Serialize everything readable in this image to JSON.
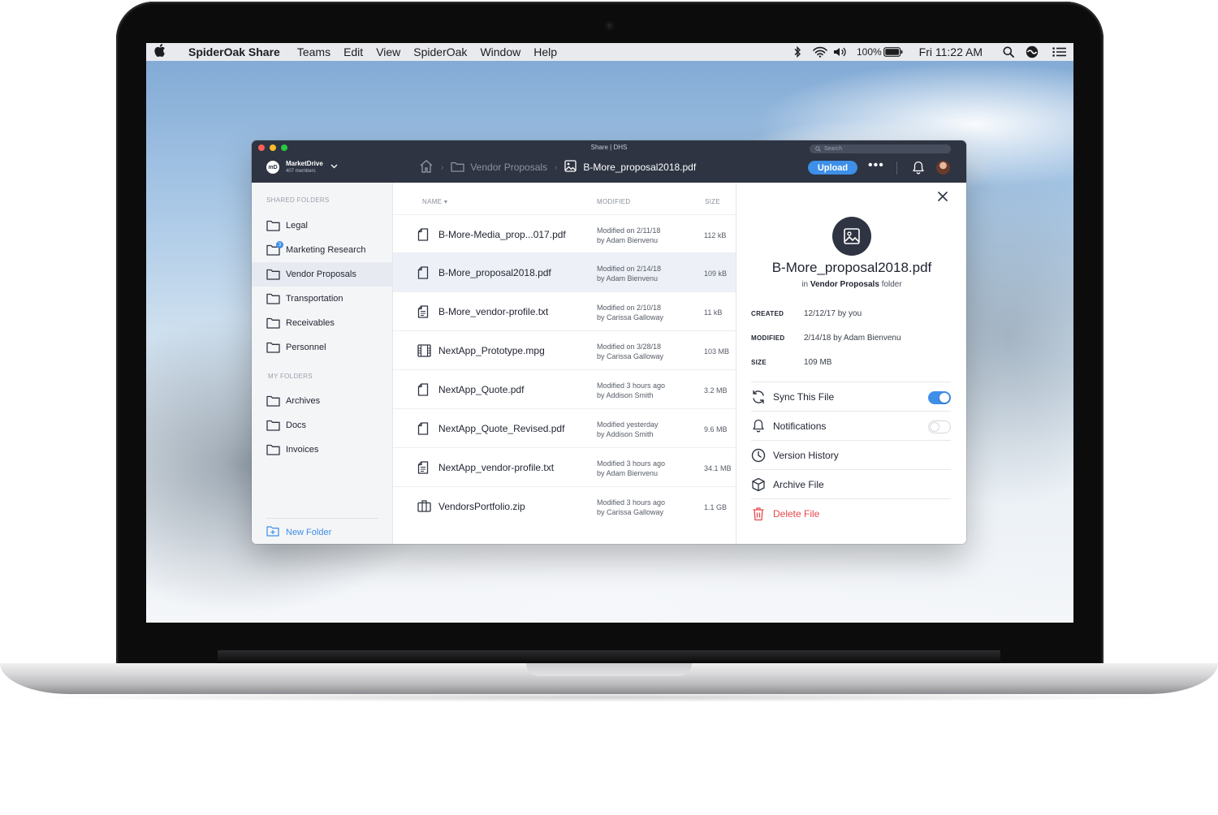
{
  "menubar": {
    "app_name": "SpiderOak Share",
    "menus": [
      "Teams",
      "Edit",
      "View",
      "SpiderOak",
      "Window",
      "Help"
    ],
    "battery": "100%",
    "clock": "Fri 11:22 AM"
  },
  "window": {
    "title": "Share | DHS",
    "search_placeholder": "Search",
    "workspace": {
      "name": "MarketDrive",
      "members": "407 members",
      "logo": "mD"
    },
    "breadcrumb": {
      "parent": "Vendor Proposals",
      "current": "B-More_proposal2018.pdf"
    },
    "upload_label": "Upload",
    "more_label": "•••"
  },
  "sidebar": {
    "shared_label": "SHARED FOLDERS",
    "shared": [
      {
        "label": "Legal"
      },
      {
        "label": "Marketing Research",
        "badge": "3"
      },
      {
        "label": "Vendor Proposals",
        "active": true
      },
      {
        "label": "Transportation"
      },
      {
        "label": "Receivables"
      },
      {
        "label": "Personnel"
      }
    ],
    "my_label": "MY FOLDERS",
    "mine": [
      {
        "label": "Archives"
      },
      {
        "label": "Docs"
      },
      {
        "label": "Invoices"
      }
    ],
    "new_folder": "New Folder"
  },
  "filelist": {
    "headers": {
      "name": "NAME ▾",
      "modified": "MODIFIED",
      "size": "SIZE"
    },
    "rows": [
      {
        "icon": "document-icon",
        "name": "B-More-Media_prop...017.pdf",
        "mod1": "Modified on 2/11/18",
        "mod2": "by Adam Bienvenu",
        "size": "112 kB"
      },
      {
        "icon": "document-icon",
        "name": "B-More_proposal2018.pdf",
        "mod1": "Modified on 2/14/18",
        "mod2": "by Adam Bienvenu",
        "size": "109 kB",
        "selected": true
      },
      {
        "icon": "text-file-icon",
        "name": "B-More_vendor-profile.txt",
        "mod1": "Modified on 2/10/18",
        "mod2": "by Carissa Galloway",
        "size": "11 kB"
      },
      {
        "icon": "video-file-icon",
        "name": "NextApp_Prototype.mpg",
        "mod1": "Modified on 3/28/18",
        "mod2": "by Carissa Galloway",
        "size": "103 MB"
      },
      {
        "icon": "document-icon",
        "name": "NextApp_Quote.pdf",
        "mod1": "Modified 3 hours ago",
        "mod2": "by Addison Smith",
        "size": "3.2 MB"
      },
      {
        "icon": "document-icon",
        "name": "NextApp_Quote_Revised.pdf",
        "mod1": "Modified yesterday",
        "mod2": "by Addison Smith",
        "size": "9.6 MB"
      },
      {
        "icon": "text-file-icon",
        "name": "NextApp_vendor-profile.txt",
        "mod1": "Modified 3 hours ago",
        "mod2": "by Adam Bienvenu",
        "size": "34.1 MB"
      },
      {
        "icon": "archive-file-icon",
        "name": "VendorsPortfolio.zip",
        "mod1": "Modified 3 hours ago",
        "mod2": "by Carissa Galloway",
        "size": "1.1 GB"
      }
    ]
  },
  "details": {
    "name": "B-More_proposal2018.pdf",
    "location_prefix": "in",
    "location_folder": "Vendor Proposals",
    "location_suffix": "folder",
    "meta": [
      {
        "label": "CREATED",
        "value": "12/12/17 by you"
      },
      {
        "label": "MODIFIED",
        "value": "2/14/18 by Adam Bienvenu"
      },
      {
        "label": "SIZE",
        "value": "109 MB"
      }
    ],
    "actions": {
      "sync": {
        "label": "Sync This File",
        "on": true
      },
      "notifications": {
        "label": "Notifications",
        "on": false
      },
      "history": {
        "label": "Version History"
      },
      "archive": {
        "label": "Archive File"
      },
      "delete": {
        "label": "Delete File"
      }
    }
  }
}
